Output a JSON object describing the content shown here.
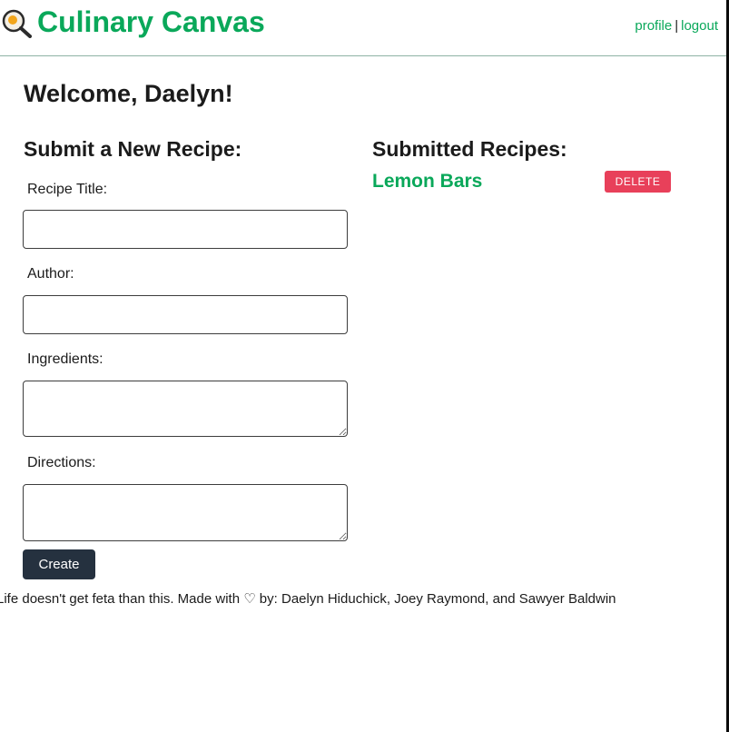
{
  "header": {
    "brand": "Culinary Canvas",
    "logo_icon": "magnifying-glass-egg-icon",
    "nav": {
      "profile_label": "profile",
      "separator": "|",
      "logout_label": "logout"
    }
  },
  "welcome": "Welcome, Daelyn!",
  "form": {
    "title": "Submit a New Recipe:",
    "fields": {
      "recipe_title": {
        "label": "Recipe Title:",
        "value": ""
      },
      "author": {
        "label": "Author:",
        "value": ""
      },
      "ingredients": {
        "label": "Ingredients:",
        "value": ""
      },
      "directions": {
        "label": "Directions:",
        "value": ""
      }
    },
    "submit_label": "Create"
  },
  "submitted": {
    "title": "Submitted Recipes:",
    "recipes": [
      {
        "name": "Lemon Bars",
        "delete_label": "DELETE"
      }
    ]
  },
  "footer": {
    "text": "Life doesn't get feta than this. Made with ♡ by: Daelyn Hiduchick, Joey Raymond, and Sawyer Baldwin"
  },
  "colors": {
    "brand_green": "#0aa85a",
    "button_dark": "#25313f",
    "delete_red": "#e8405a",
    "header_border": "#8fb3a5"
  }
}
